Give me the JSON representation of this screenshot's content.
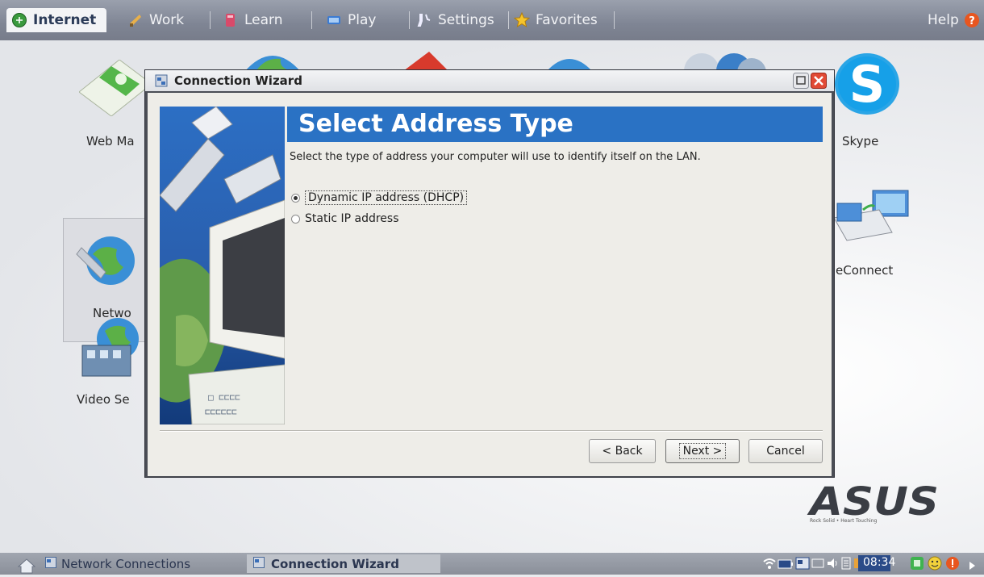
{
  "topbar": {
    "tabs": [
      {
        "label": "Internet",
        "icon": "globe-icon"
      },
      {
        "label": "Work",
        "icon": "work-icon"
      },
      {
        "label": "Learn",
        "icon": "learn-icon"
      },
      {
        "label": "Play",
        "icon": "play-icon"
      },
      {
        "label": "Settings",
        "icon": "settings-icon"
      },
      {
        "label": "Favorites",
        "icon": "star-icon"
      }
    ],
    "help_label": "Help"
  },
  "desktop": {
    "icons": [
      {
        "label": "Web Ma",
        "icon": "web-mail-icon"
      },
      {
        "label": "Netwo",
        "icon": "network-icon"
      },
      {
        "label": "Video Se",
        "icon": "video-search-icon"
      },
      {
        "label": "Skype",
        "icon": "skype-icon"
      },
      {
        "label": "eConnect",
        "icon": "econnect-icon"
      }
    ],
    "brand": {
      "name": "ASUS",
      "tagline": "Rock Solid • Heart Touching"
    }
  },
  "dialog": {
    "title": "Connection Wizard",
    "header": "Select Address Type",
    "description": "Select the type of address your computer will use to identify itself on the LAN.",
    "options": [
      {
        "label": "Dynamic IP address (DHCP)",
        "selected": true
      },
      {
        "label": "Static IP address",
        "selected": false
      }
    ],
    "buttons": {
      "back": "< Back",
      "next": "Next >",
      "cancel": "Cancel"
    }
  },
  "taskbar": {
    "tasks": [
      "Network Connections",
      "Connection Wizard"
    ],
    "clock": "08:34"
  },
  "colors": {
    "accent": "#2a72c4",
    "dialog_bg": "#eeede8"
  }
}
